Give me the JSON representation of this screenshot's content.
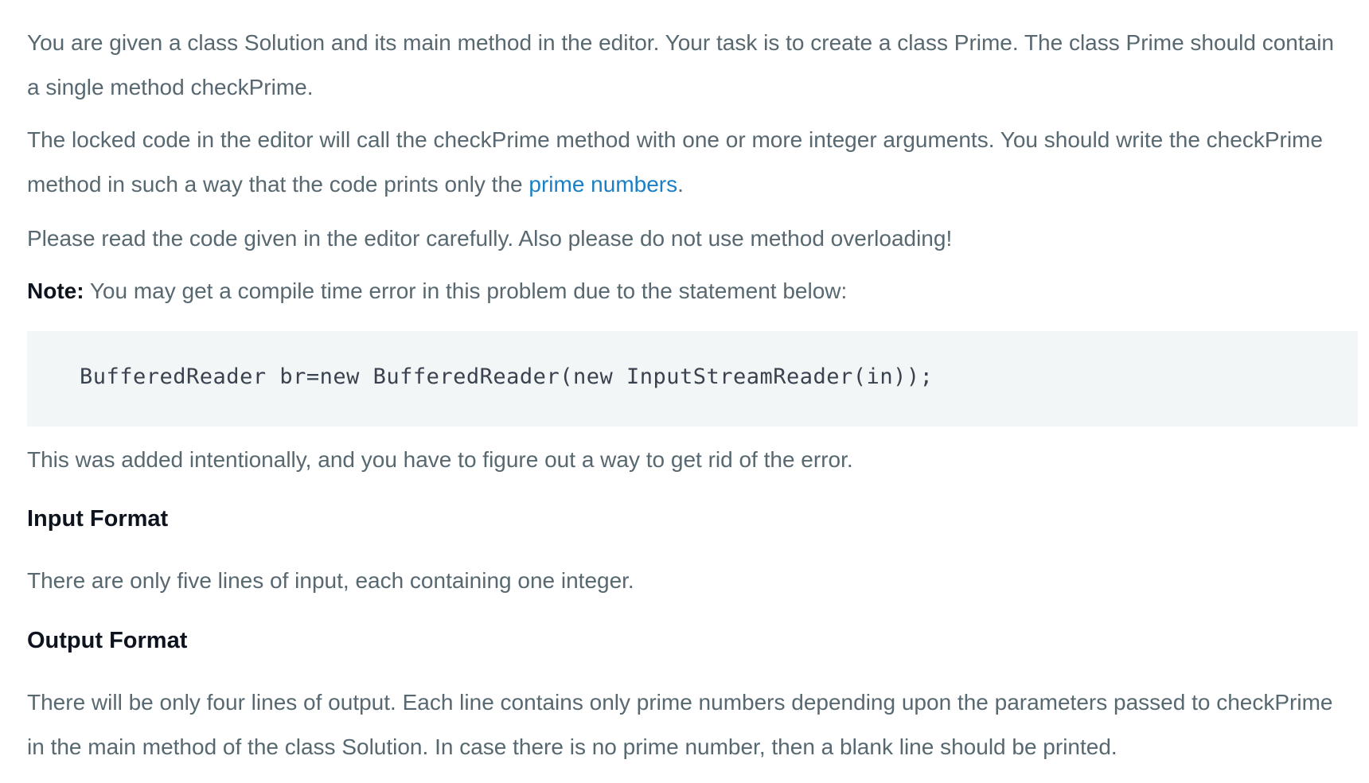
{
  "problem": {
    "intro": "You are given a class Solution and its main method in the editor. Your task is to create a class Prime. The class Prime should contain a single method checkPrime.",
    "locked_code_text_before_link": "The locked code in the editor will call the checkPrime method with one or more integer arguments. You should write the checkPrime method in such a way that the code prints only the ",
    "prime_numbers_link": "prime numbers",
    "locked_code_text_after_link": ".",
    "read_carefully": "Please read the code given in the editor carefully. Also please do not use method overloading!",
    "note_label": "Note:",
    "note_text": " You may get a compile time error in this problem due to the statement below:",
    "code_snippet": "BufferedReader br=new BufferedReader(new InputStreamReader(in));",
    "added_intentionally": "This was added intentionally, and you have to figure out a way to get rid of the error.",
    "input_format_heading": "Input Format",
    "input_format_text": "There are only five lines of input, each containing one integer.",
    "output_format_heading": "Output Format",
    "output_format_text": "There will be only four lines of output. Each line contains only prime numbers depending upon the parameters passed to checkPrime in the main method of the class Solution. In case there is no prime number, then a blank line should be printed."
  },
  "colors": {
    "body_text": "#576871",
    "heading_text": "#0e141e",
    "link": "#1a7fc4",
    "code_background": "#f3f6f7"
  }
}
